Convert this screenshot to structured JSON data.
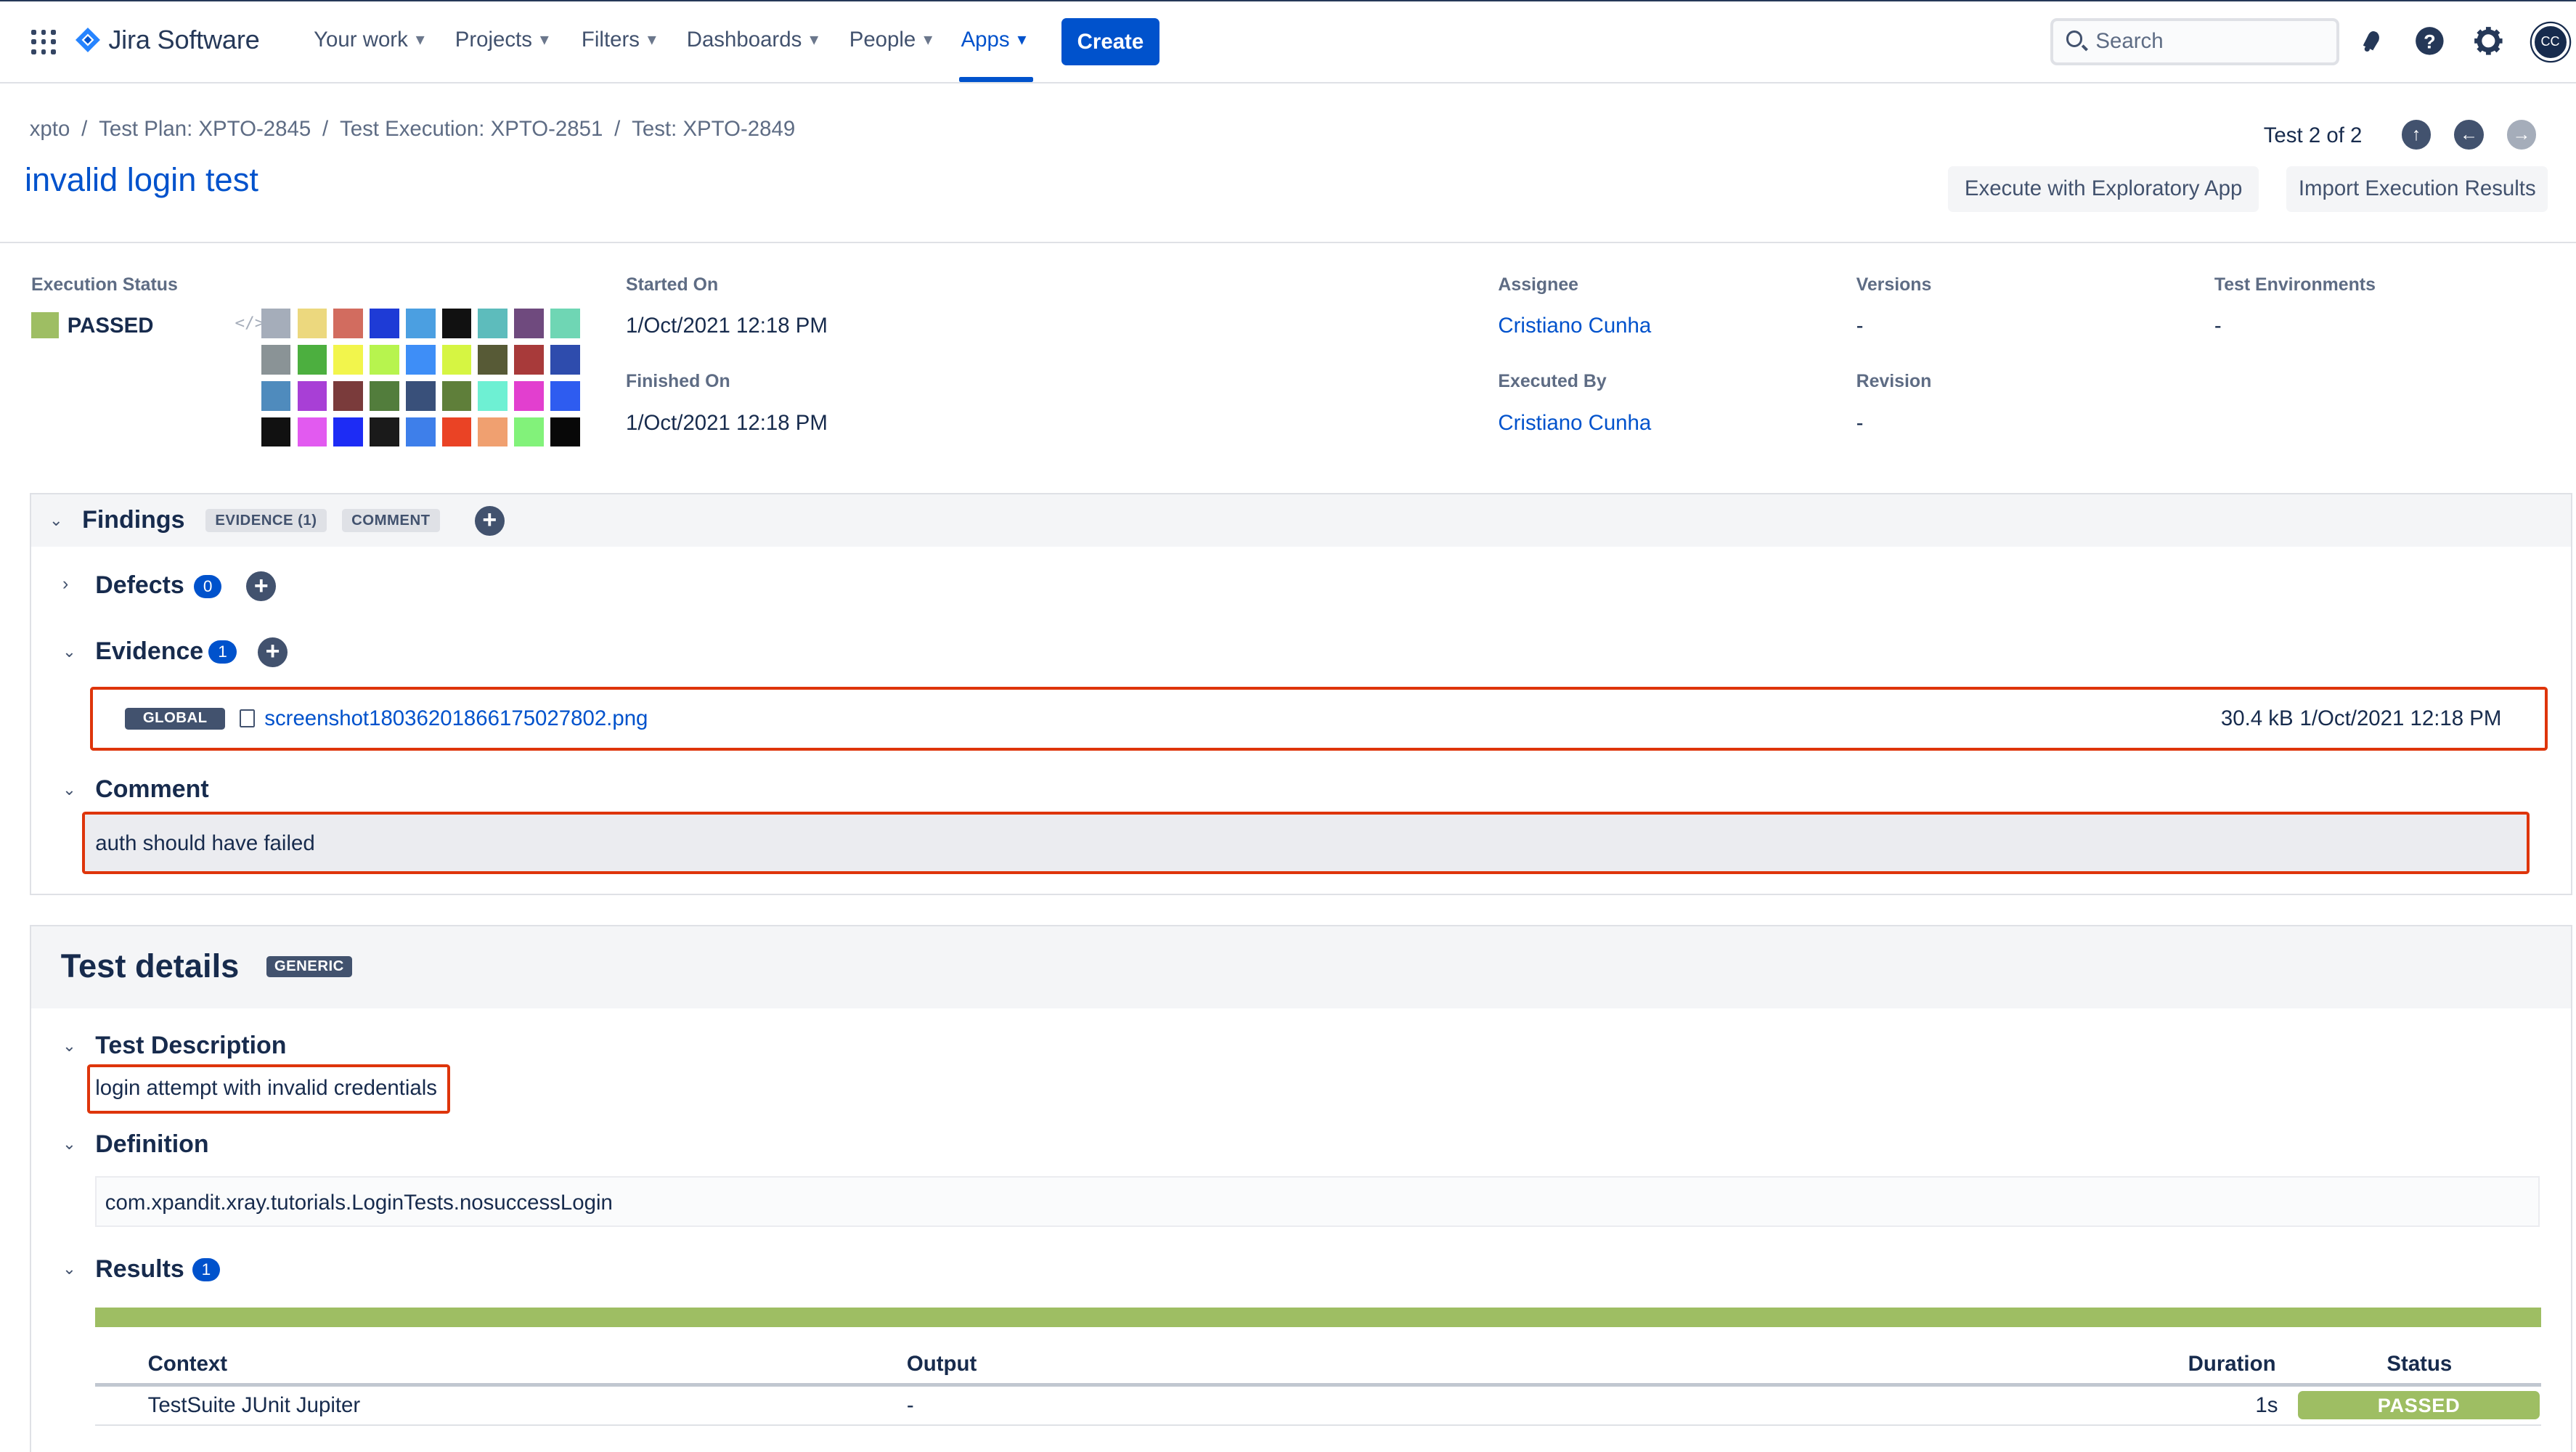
{
  "app": {
    "name": "Jira Software"
  },
  "nav": {
    "items": [
      {
        "label": "Your work"
      },
      {
        "label": "Projects"
      },
      {
        "label": "Filters"
      },
      {
        "label": "Dashboards"
      },
      {
        "label": "People"
      },
      {
        "label": "Apps"
      }
    ],
    "create_label": "Create",
    "search_placeholder": "Search",
    "avatar_initials": "CC"
  },
  "breadcrumbs": [
    "xpto",
    "Test Plan: XPTO-2845",
    "Test Execution: XPTO-2851",
    "Test: XPTO-2849"
  ],
  "page_title": "invalid login test",
  "pager": {
    "text": "Test 2 of 2"
  },
  "actions": {
    "exploratory": "Execute with Exploratory App",
    "import": "Import Execution Results"
  },
  "execution": {
    "status_label": "Execution Status",
    "status_value": "PASSED",
    "status_color": "#9ebe63",
    "started_label": "Started On",
    "started_value": "1/Oct/2021 12:18 PM",
    "finished_label": "Finished On",
    "finished_value": "1/Oct/2021 12:18 PM",
    "assignee_label": "Assignee",
    "assignee_value": "Cristiano Cunha",
    "executed_by_label": "Executed By",
    "executed_by_value": "Cristiano Cunha",
    "versions_label": "Versions",
    "versions_value": "-",
    "revision_label": "Revision",
    "revision_value": "-",
    "environments_label": "Test Environments",
    "environments_value": "-",
    "palette": [
      "#a5adba",
      "#ecd87e",
      "#d26c5f",
      "#1e3bd6",
      "#4b9fe1",
      "#111111",
      "#5dbcbc",
      "#6f4a7e",
      "#6fd6b4",
      "#8a9396",
      "#4caf3f",
      "#f2f54c",
      "#b7f44e",
      "#3e8ef7",
      "#d6f542",
      "#575a36",
      "#a83a3a",
      "#2e4cad",
      "#4f8bbd",
      "#a83fd6",
      "#7a3b3b",
      "#527d3c",
      "#39507a",
      "#5f7f3a",
      "#6ef0d3",
      "#e23fcf",
      "#2e5cf0",
      "#111111",
      "#e25af0",
      "#1d2cf5",
      "#1a1a1a",
      "#3e7fea",
      "#ea4325",
      "#f0a070",
      "#82f27a",
      "#080808"
    ]
  },
  "findings": {
    "title": "Findings",
    "tabs": [
      "EVIDENCE (1)",
      "COMMENT"
    ],
    "defects": {
      "title": "Defects",
      "count": "0"
    },
    "evidence": {
      "title": "Evidence",
      "count": "1",
      "items": [
        {
          "scope": "GLOBAL",
          "filename": "screenshot1803620186617502780​2.png",
          "size": "30.4 kB",
          "date": "1/Oct/2021 12:18 PM"
        }
      ]
    },
    "comment": {
      "title": "Comment",
      "text": "auth should have failed"
    }
  },
  "test_details": {
    "title": "Test details",
    "type_tag": "GENERIC",
    "description": {
      "title": "Test Description",
      "text": "login attempt with invalid credentials"
    },
    "definition": {
      "title": "Definition",
      "text": "com.xpandit.xray.tutorials.LoginTests.nosuccessLogin"
    },
    "results": {
      "title": "Results",
      "count": "1",
      "progress_passed_fraction": 1.0,
      "columns": [
        "Context",
        "Output",
        "Duration",
        "Status"
      ],
      "rows": [
        {
          "context": "TestSuite JUnit Jupiter",
          "output": "-",
          "duration": "1s",
          "status": "PASSED"
        }
      ]
    }
  }
}
